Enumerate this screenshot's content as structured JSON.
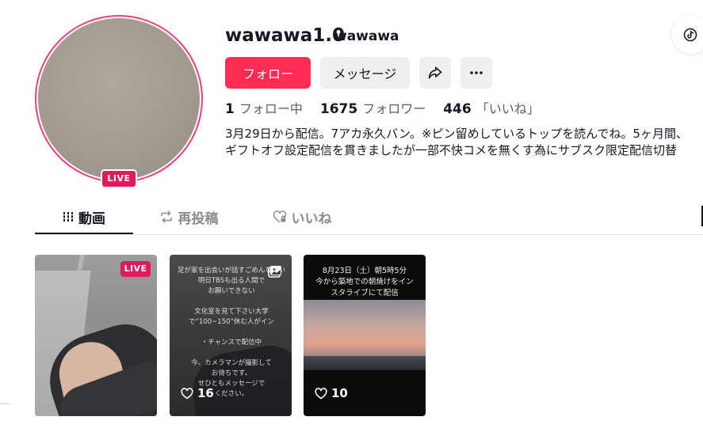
{
  "profile": {
    "username": "wawawa1.0",
    "nickname": "wawawa",
    "live_badge": "LIVE",
    "bio": "3月29日から配信。7アカ永久バン。※ピン留めしているトップを読んでね。5ヶ月間、ギフトオフ設定配信を貫きましたが一部不快コメを無くす為にサブスク限定配信切替"
  },
  "actions": {
    "follow_label": "フォロー",
    "message_label": "メッセージ",
    "share_icon": "share-icon",
    "more_icon": "more-icon"
  },
  "stats": {
    "following_count": "1",
    "following_label": "フォロー中",
    "followers_count": "1675",
    "followers_label": "フォロワー",
    "likes_count": "446",
    "likes_label": "「いいね」"
  },
  "tabs": [
    {
      "label": "動画",
      "icon": "grid-icon",
      "active": true
    },
    {
      "label": "再投稿",
      "icon": "repost-icon",
      "active": false
    },
    {
      "label": "いいね",
      "icon": "heart-icon",
      "active": false
    }
  ],
  "videos": [
    {
      "badge": "LIVE",
      "likes": ""
    },
    {
      "badge": "photo-icon",
      "likes": "16",
      "overlay_text": "足が家を出会いが話すごめんなさい\n明日TBSも出る人間で\nお願いできない\n\n文化室を見て下さい大学\nで“100~150”休む人がイン\n\n・チャンスで配信中\n\n今、カメラマンが撮影して\nお待ちです。\nせひともメッセージで\nください。"
    },
    {
      "badge": "",
      "likes": "10",
      "overlay_text": "8月23日（土）朝5時5分\n今から築地での朝焼けをイン\nスタライブにて配信"
    }
  ],
  "colors": {
    "accent": "#fe2c55",
    "live": "#e2195a",
    "avatar_ring": "#e8407a"
  }
}
